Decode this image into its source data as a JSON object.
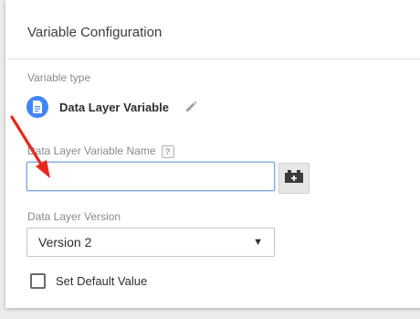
{
  "panel": {
    "title": "Variable Configuration"
  },
  "variable_type": {
    "label": "Variable type",
    "name": "Data Layer Variable",
    "icon": "document-icon",
    "icon_color": "#4285f4",
    "edit_icon": "pencil-icon"
  },
  "variable_name": {
    "label": "Data Layer Variable Name",
    "help": "?",
    "value": "",
    "placeholder": "",
    "insert_variable_icon": "lego-brick-icon"
  },
  "version": {
    "label": "Data Layer Version",
    "selected": "Version 2",
    "dropdown_icon": "triangle-down-icon"
  },
  "default_value": {
    "label": "Set Default Value",
    "checked": false
  },
  "annotation": {
    "arrow_color": "#e8281e"
  }
}
